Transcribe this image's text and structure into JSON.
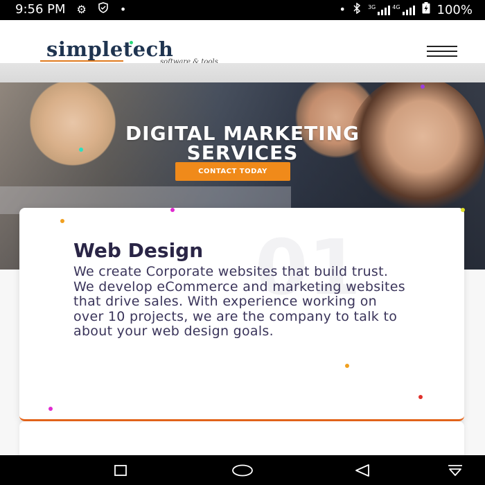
{
  "status_bar": {
    "time": "9:56 PM",
    "network_3g": "3G",
    "network_4g": "4G",
    "battery": "100%"
  },
  "header": {
    "logo_text": "simpletech",
    "logo_tagline": "software & tools"
  },
  "hero": {
    "title_line1": "DIGITAL MARKETING",
    "title_line2": "SERVICES",
    "cta_label": "CONTACT TODAY"
  },
  "card": {
    "number": "01",
    "title": "Web Design",
    "text": "We create Corporate websites that build trust. We develop eCommerce and marketing websites that drive sales. With experience working on over 10 projects, we are the company to talk to about your web design goals."
  },
  "colors": {
    "accent_orange": "#f08a1a",
    "logo_blue": "#1f3450",
    "card_text": "#3a345a"
  },
  "icons": [
    "settings-icon",
    "shield-icon",
    "bluetooth-icon",
    "signal-icon",
    "battery-icon",
    "menu-icon",
    "recents-icon",
    "home-icon",
    "back-icon",
    "notification-icon"
  ]
}
